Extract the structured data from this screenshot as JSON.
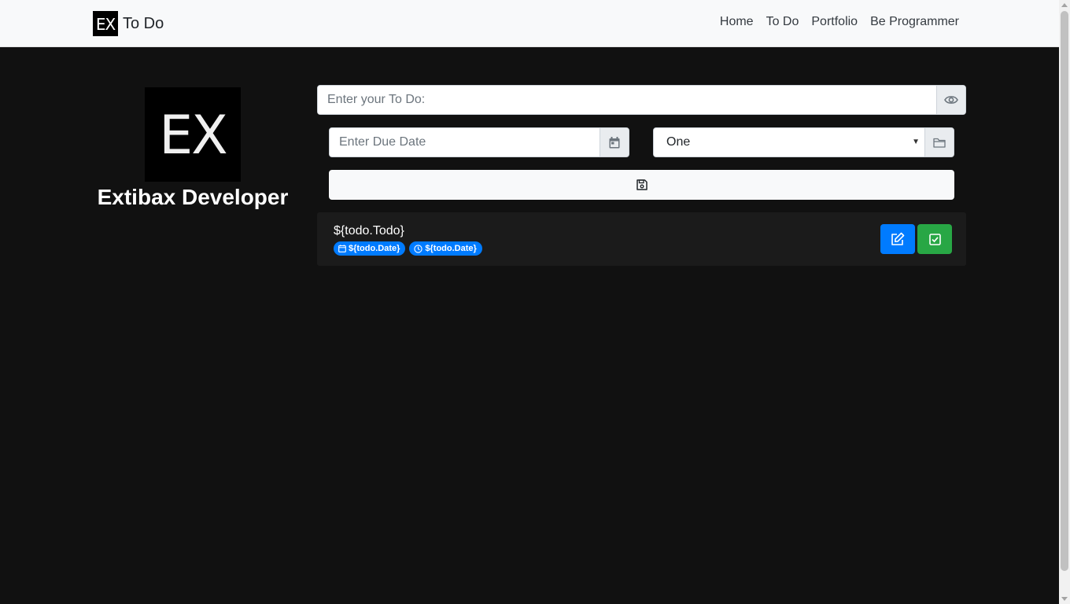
{
  "navbar": {
    "brand_logo": "EX",
    "brand_text": "To Do",
    "links": [
      "Home",
      "To Do",
      "Portfolio",
      "Be Programmer"
    ]
  },
  "profile": {
    "logo": "EX",
    "name": "Extibax Developer"
  },
  "form": {
    "todo_placeholder": "Enter your To Do:",
    "due_date_placeholder": "Enter Due Date",
    "category_selected": "One"
  },
  "todos": [
    {
      "text": "${todo.Todo}",
      "date_badge": "${todo.Date}",
      "time_badge": "${todo.Date}"
    }
  ],
  "icons": {
    "show": "eye-icon",
    "calendar": "calendar-icon",
    "folder": "folder-icon",
    "save": "save-icon",
    "edit": "edit-icon",
    "done": "check-square-icon"
  },
  "colors": {
    "background": "#111111",
    "navbar": "#f8f9fa",
    "primary": "#007bff",
    "success": "#28a745"
  }
}
